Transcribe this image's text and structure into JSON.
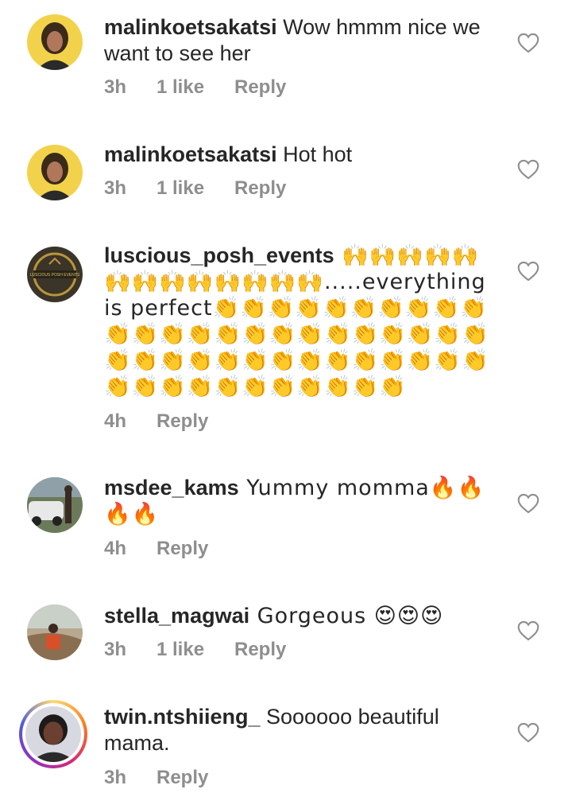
{
  "comments": [
    {
      "username": "malinkoetsakatsi",
      "text": " Wow hmmm nice we want to see her",
      "time": "3h",
      "likes": "1 like",
      "reply": "Reply"
    },
    {
      "username": "malinkoetsakatsi",
      "text": " Hot hot",
      "time": "3h",
      "likes": "1 like",
      "reply": "Reply"
    },
    {
      "username": "luscious_posh_events",
      "text": " 🙌🙌🙌🙌🙌🙌🙌🙌🙌🙌🙌🙌🙌.....everything is perfect👏👏👏👏👏👏👏👏👏👏👏👏👏👏👏👏👏👏👏👏👏👏👏👏👏👏👏👏👏👏👏👏👏👏👏👏👏👏👏👏👏👏👏👏👏👏👏👏👏",
      "avatar_logo_text": "LUSCIOUS POSH EVENTS",
      "time": "4h",
      "reply": "Reply"
    },
    {
      "username": "msdee_kams",
      "text": " Yummy momma🔥🔥🔥🔥 ",
      "text_tail": "",
      "time": "4h",
      "reply": "Reply"
    },
    {
      "username": "stella_magwai",
      "text": " Gorgeous 😍😍😍",
      "time": "3h",
      "likes": "1 like",
      "reply": "Reply"
    },
    {
      "username": "twin.ntshiieng_",
      "text": " Soooooo beautiful mama. ",
      "time": "3h",
      "reply": "Reply"
    }
  ],
  "icons": {
    "like": "heart-outline-icon",
    "story_ring": "gradient-story-ring"
  },
  "colors": {
    "text": "#262626",
    "meta": "#8e8e8e"
  }
}
